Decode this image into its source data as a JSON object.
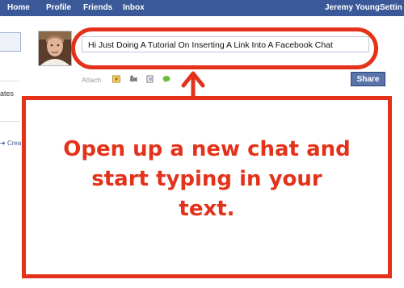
{
  "nav": {
    "home": "Home",
    "profile": "Profile",
    "friends": "Friends",
    "inbox": "Inbox",
    "user": "Jeremy Young",
    "settings": "Settin"
  },
  "left": {
    "updates_fragment": "ates",
    "create_fragment": "Crea"
  },
  "status": {
    "value": "Hi Just Doing A Tutorial On Inserting A Link Into A Facebook Chat"
  },
  "attach": {
    "label": "Attach"
  },
  "share": {
    "label": "Share"
  },
  "annotation": {
    "line1": "Open up a new chat and",
    "line2": "start typing in your",
    "line3": "text."
  },
  "colors": {
    "facebook_blue": "#3b5998",
    "annotation_red": "#e4321a"
  },
  "icons": [
    "photo-icon",
    "video-icon",
    "link-icon",
    "speech-bubble-icon"
  ]
}
